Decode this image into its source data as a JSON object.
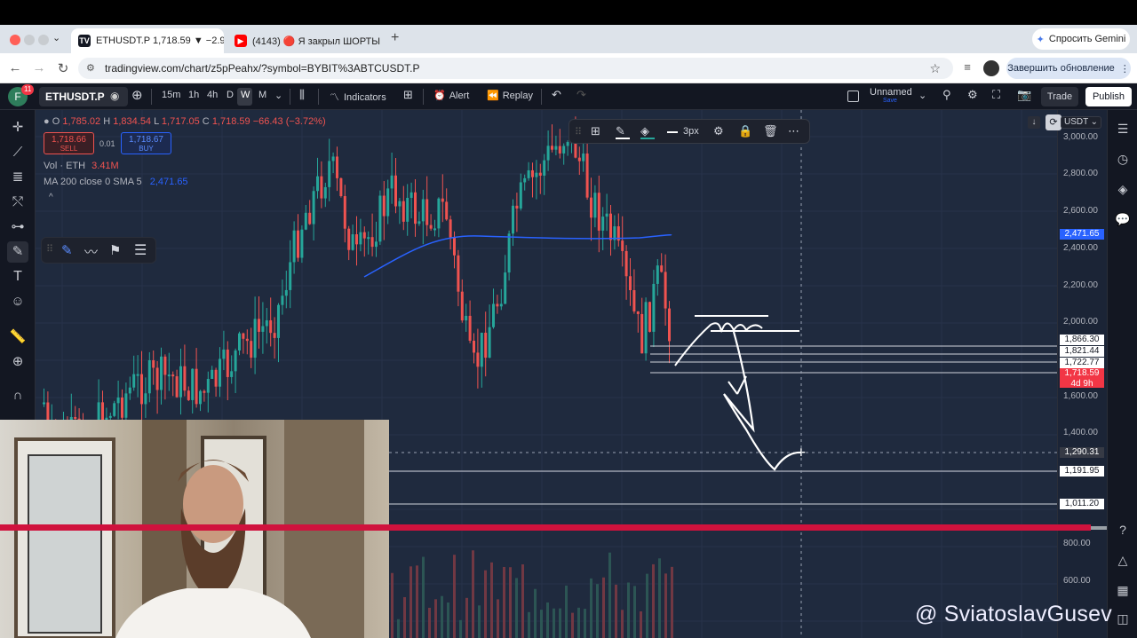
{
  "browser": {
    "tabs": [
      {
        "title": "ETHUSDT.P 1,718.59 ▼ −2.9",
        "active": true
      },
      {
        "title": "(4143) 🔴 Я закрыл ШОРТЫ",
        "active": false
      }
    ],
    "new_tab": "+",
    "gemini_button": "Спросить Gemini",
    "url": "tradingview.com/chart/z5pPeahx/?symbol=BYBIT%3ABTCUSDT.P",
    "update_button": "Завершить обновление"
  },
  "tv_toolbar": {
    "avatar": "F",
    "avatar_badge": "11",
    "symbol": "ETHUSDT.P",
    "intervals": [
      "15m",
      "1h",
      "4h",
      "D",
      "W",
      "M"
    ],
    "active_interval": "W",
    "indicators": "Indicators",
    "alert": "Alert",
    "replay": "Replay",
    "layout_name": "Unnamed",
    "layout_sub": "Save",
    "trade": "Trade",
    "publish": "Publish"
  },
  "legend": {
    "ohlc": {
      "o_label": "O",
      "o": "1,785.02",
      "h_label": "H",
      "h": "1,834.54",
      "l_label": "L",
      "l": "1,717.05",
      "c_label": "C",
      "c": "1,718.59",
      "chg": "−66.43 (−3.72%)"
    },
    "sell_price": "1,718.66",
    "sell_label": "SELL",
    "spread": "0.01",
    "buy_price": "1,718.67",
    "buy_label": "BUY",
    "vol_label": "Vol · ETH",
    "vol_value": "3.41M",
    "ma_label": "MA 200 close 0 SMA 5",
    "ma_value": "2,471.65",
    "collapse": "^"
  },
  "drawing_bar": {
    "width_label": "3px"
  },
  "price_scale": {
    "currency": "USDT",
    "labels": [
      "3,000.00",
      "2,800.00",
      "2,600.00",
      "2,400.00",
      "2,200.00",
      "2,000.00",
      "1,600.00",
      "1,400.00",
      "800.00",
      "600.00"
    ],
    "tags": {
      "ma": "2,471.65",
      "h1": "1,866.30",
      "h2": "1,821.44",
      "h3": "1,722.77",
      "last": "1,718.59",
      "countdown": "4d 9h",
      "crosshair": "1,290.31",
      "s1": "1,191.95",
      "s2": "1,011.20"
    }
  },
  "watermark": "@ SviatoslavGusev",
  "colors": {
    "up": "#26a69a",
    "down": "#ef5350",
    "ma": "#2962ff",
    "bg": "#1f2a3e"
  }
}
